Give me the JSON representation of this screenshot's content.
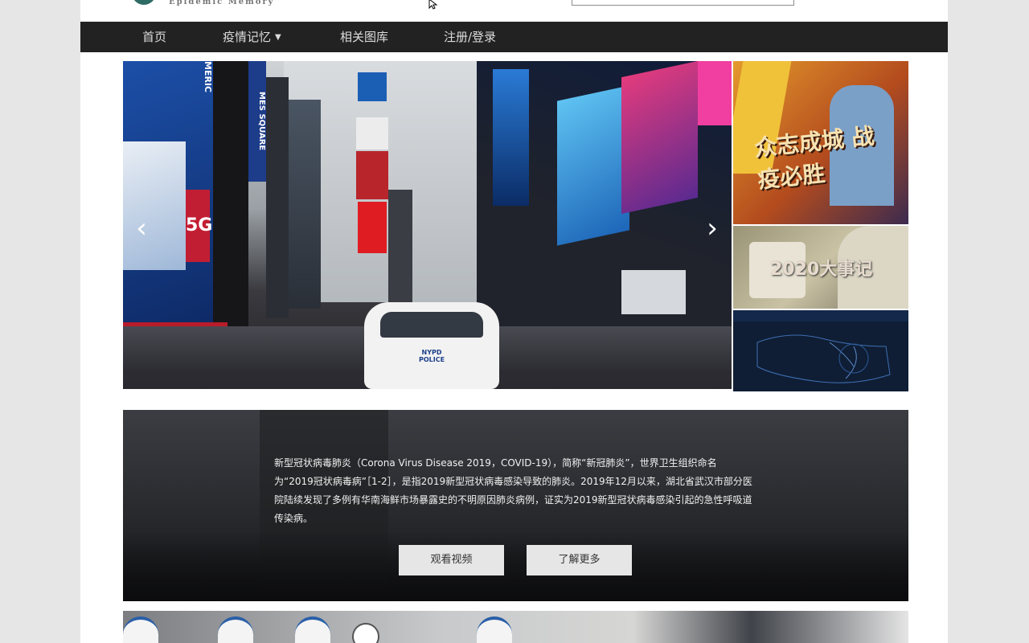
{
  "header": {
    "logo_subtitle": "Epidemic Memory"
  },
  "nav": {
    "items": [
      {
        "label": "首页"
      },
      {
        "label": "疫情记忆",
        "has_dropdown": true
      },
      {
        "label": "相关图库"
      },
      {
        "label": "注册/登录"
      }
    ]
  },
  "carousel": {
    "prev_symbol": "‹",
    "next_symbol": "›",
    "sign_left": "MES SQUARE",
    "sign_left2": "MERIC",
    "sign_5g": "5G",
    "car_text": "NYPD\nPOLICE"
  },
  "thumbnails": [
    {
      "title": "众志成城 战疫必胜"
    },
    {
      "title": "2020大事记"
    },
    {
      "title": ""
    }
  ],
  "info": {
    "text": "新型冠状病毒肺炎（Corona Virus Disease 2019，COVID-19），简称“新冠肺炎”，世界卫生组织命名为“2019冠状病毒病”［1-2］，是指2019新型冠状病毒感染导致的肺炎。2019年12月以来，湖北省武汉市部分医院陆续发现了多例有华南海鲜市场暴露史的不明原因肺炎病例，证实为2019新型冠状病毒感染引起的急性呼吸道传染病。",
    "watch_video": "观看视频",
    "learn_more": "了解更多"
  },
  "colors": {
    "nav_bg": "#222222",
    "page_bg": "#e6e6e6",
    "button_bg": "#e6e6e6"
  }
}
